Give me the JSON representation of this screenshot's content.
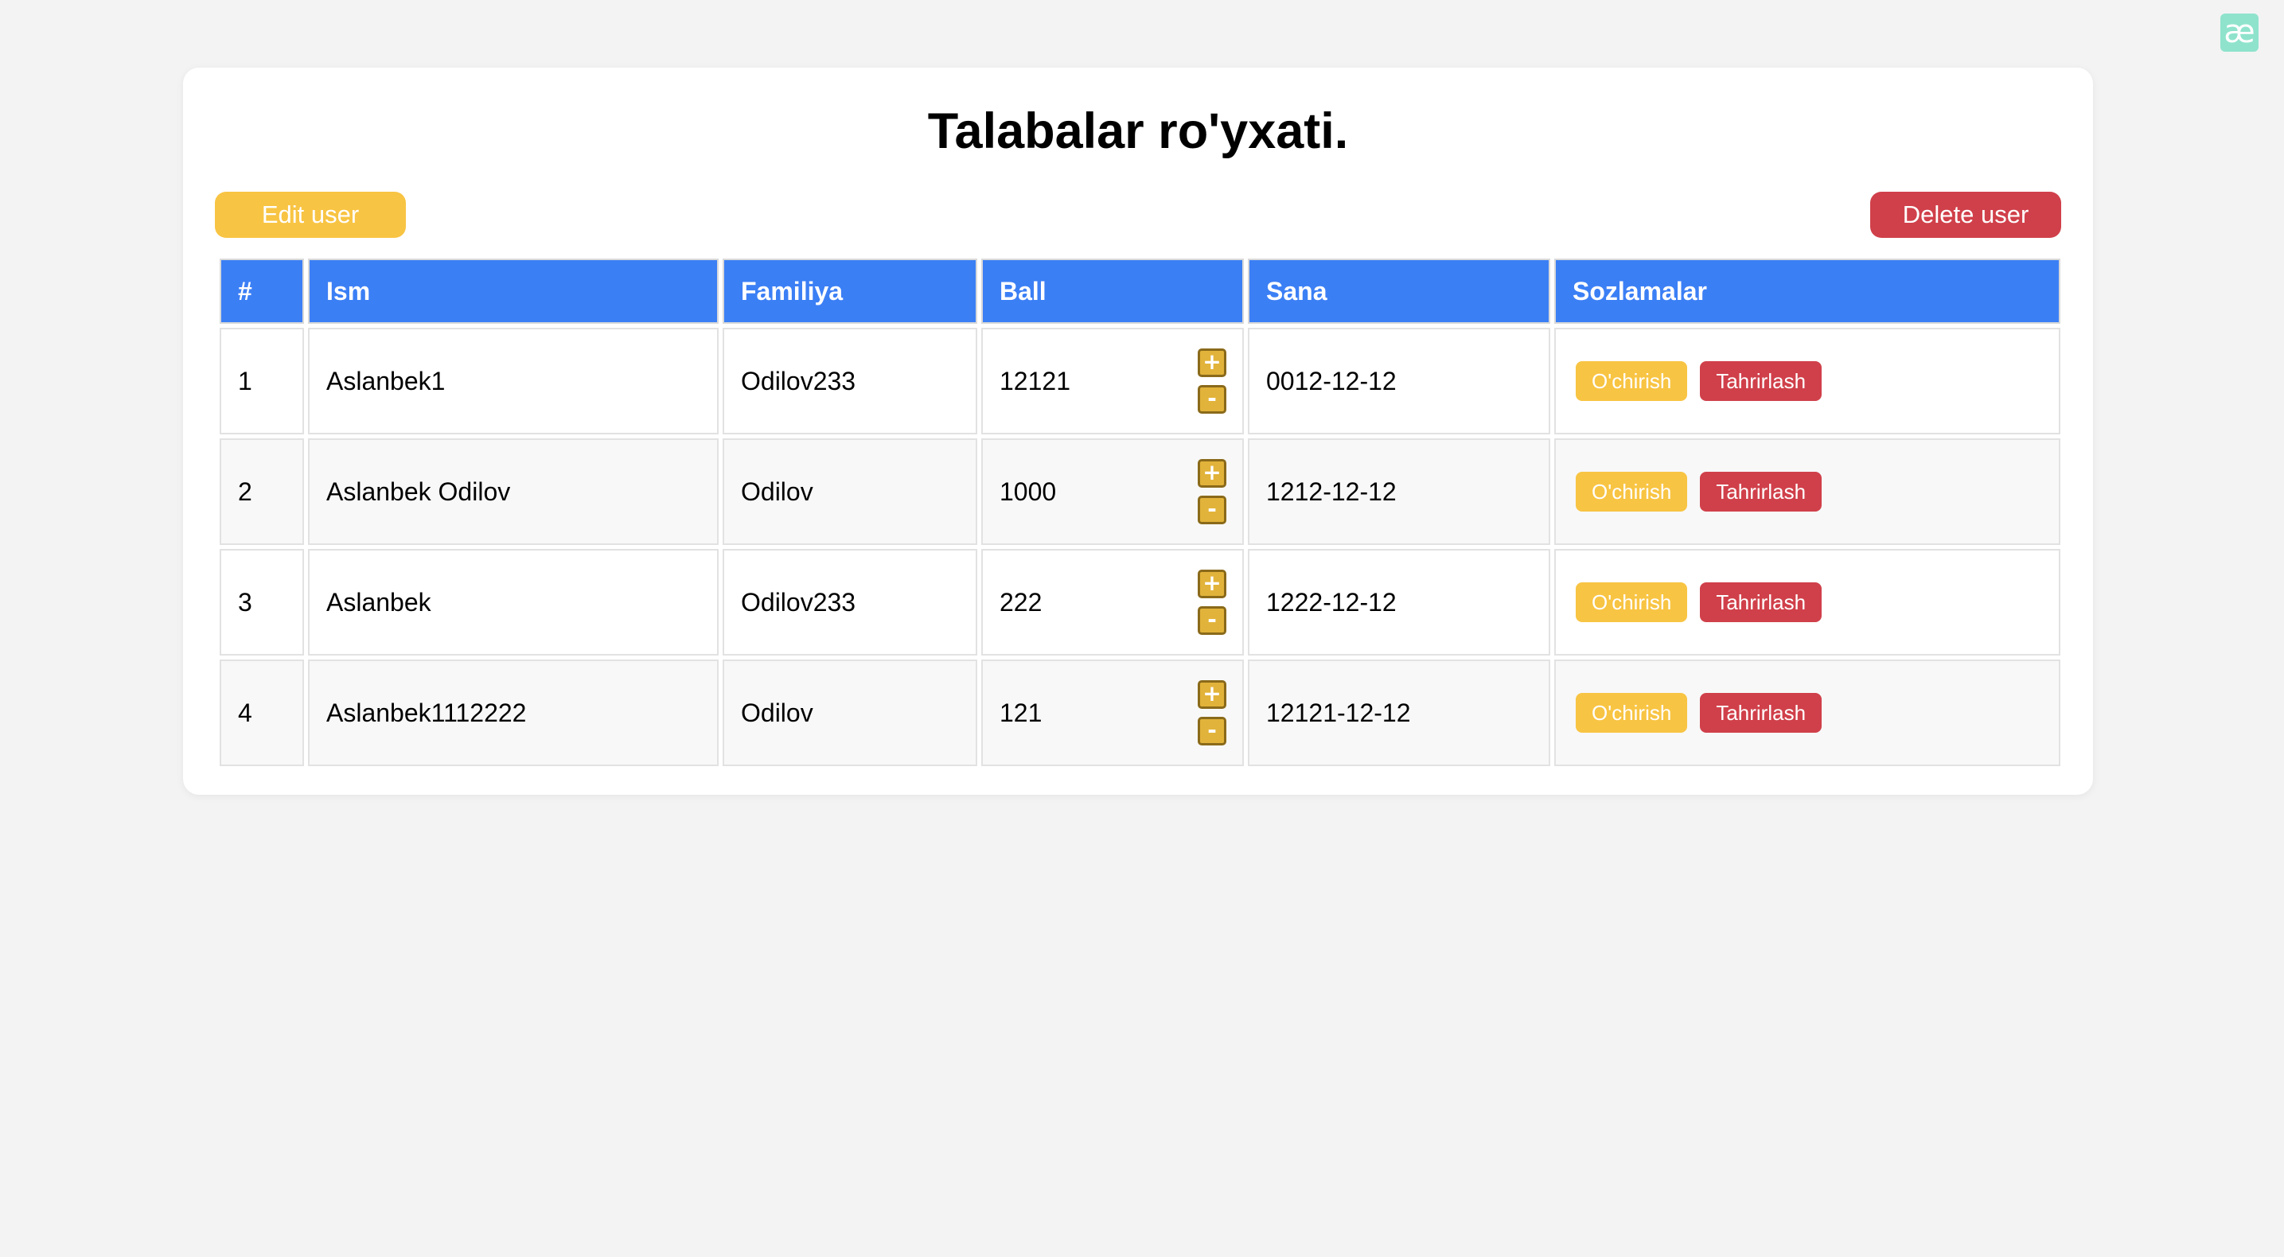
{
  "extension_icon": {
    "glyph": "æ",
    "color": "#8fe3cc"
  },
  "page": {
    "title": "Talabalar ro'yxati."
  },
  "toolbar": {
    "edit_label": "Edit user",
    "delete_label": "Delete user"
  },
  "colors": {
    "header_bg": "#3b7ff5",
    "warning": "#f8c443",
    "danger": "#d0404a",
    "background": "#f3f3f3"
  },
  "table": {
    "headers": [
      "#",
      "Ism",
      "Familiya",
      "Ball",
      "Sana",
      "Sozlamalar"
    ],
    "rows": [
      {
        "num": "1",
        "ism": "Aslanbek1",
        "familiya": "Odilov233",
        "ball": "12121",
        "sana": "0012-12-12"
      },
      {
        "num": "2",
        "ism": "Aslanbek Odilov",
        "familiya": "Odilov",
        "ball": "1000",
        "sana": "1212-12-12"
      },
      {
        "num": "3",
        "ism": "Aslanbek",
        "familiya": "Odilov233",
        "ball": "222",
        "sana": "1222-12-12"
      },
      {
        "num": "4",
        "ism": "Aslanbek1112222",
        "familiya": "Odilov",
        "ball": "121",
        "sana": "12121-12-12"
      }
    ],
    "increment_symbol": "+",
    "decrement_symbol": "-",
    "delete_action": "O'chirish",
    "edit_action": "Tahrirlash"
  }
}
